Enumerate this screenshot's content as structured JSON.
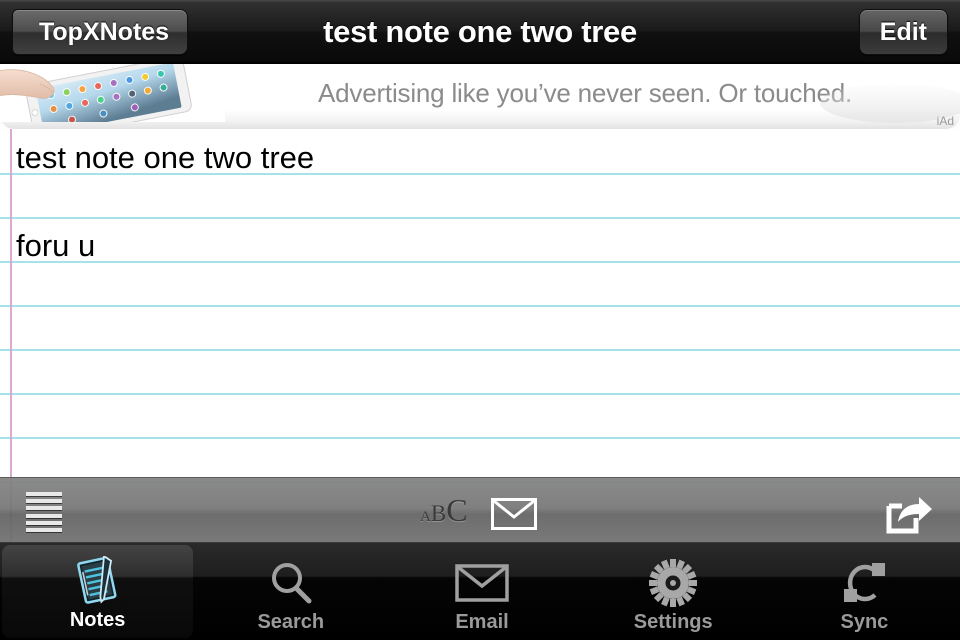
{
  "navbar": {
    "back_label": "TopXNotes",
    "title": "test note one two tree",
    "edit_label": "Edit"
  },
  "ad": {
    "text": "Advertising like you’ve never seen. Or touched.",
    "provider_label": "iAd",
    "image_description": "hand-touching-ipad"
  },
  "note": {
    "lines": [
      "test note one two tree",
      "foru u"
    ],
    "rule_color": "#a6e2ea",
    "margin_color": "#dba8cf",
    "paper_color": "#ffffff"
  },
  "note_toolbar": {
    "items": [
      {
        "name": "notes-list-icon",
        "label": ""
      },
      {
        "name": "font-size-icon",
        "label": "ABC"
      },
      {
        "name": "email-note-icon",
        "label": ""
      },
      {
        "name": "share-note-icon",
        "label": ""
      }
    ],
    "abc": {
      "a": "A",
      "b": "B",
      "c": "C"
    }
  },
  "tabbar": {
    "selected": "Notes",
    "tabs": [
      {
        "label": "Notes",
        "icon": "notes-icon",
        "selected": true
      },
      {
        "label": "Search",
        "icon": "search-icon",
        "selected": false
      },
      {
        "label": "Email",
        "icon": "email-icon",
        "selected": false
      },
      {
        "label": "Settings",
        "icon": "gear-icon",
        "selected": false
      },
      {
        "label": "Sync",
        "icon": "sync-icon",
        "selected": false
      }
    ]
  },
  "colors": {
    "accent": "#4ec3e0",
    "nav_bg": "#1a1a1a",
    "tab_inactive": "#9a9a9a",
    "tab_active": "#ffffff"
  }
}
